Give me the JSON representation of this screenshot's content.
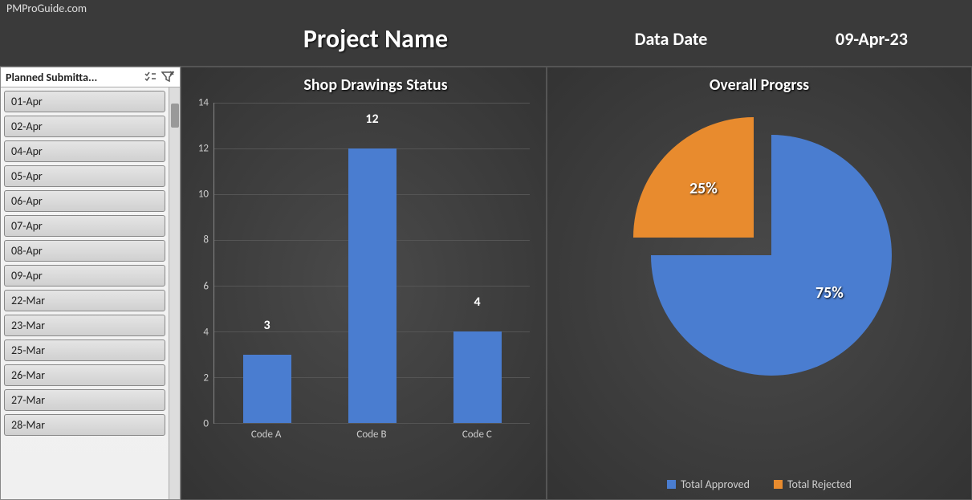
{
  "site_label": "PMProGuide.com",
  "header": {
    "project_name": "Project Name",
    "data_date_label": "Data Date",
    "data_date_value": "09-Apr-23"
  },
  "slicer": {
    "title": "Planned Submitta...",
    "items": [
      "01-Apr",
      "02-Apr",
      "04-Apr",
      "05-Apr",
      "06-Apr",
      "07-Apr",
      "08-Apr",
      "09-Apr",
      "22-Mar",
      "23-Mar",
      "25-Mar",
      "26-Mar",
      "27-Mar",
      "28-Mar"
    ]
  },
  "bar_chart": {
    "title": "Shop Drawings Status"
  },
  "pie_chart": {
    "title": "Overall Progrss",
    "slice1_label": "75%",
    "slice2_label": "25%",
    "legend1": "Total Approved",
    "legend2": "Total Rejected"
  },
  "chart_data": [
    {
      "type": "bar",
      "title": "Shop Drawings Status",
      "categories": [
        "Code A",
        "Code B",
        "Code C"
      ],
      "values": [
        3,
        12,
        4
      ],
      "ylim": [
        0,
        14
      ],
      "yticks": [
        0,
        2,
        4,
        6,
        8,
        10,
        12,
        14
      ],
      "color": "#4a7dd0"
    },
    {
      "type": "pie",
      "title": "Overall Progrss",
      "series": [
        {
          "name": "Total Approved",
          "value": 75,
          "color": "#4a7dd0",
          "label": "75%"
        },
        {
          "name": "Total Rejected",
          "value": 25,
          "color": "#e88b2e",
          "label": "25%",
          "exploded": true
        }
      ]
    }
  ]
}
